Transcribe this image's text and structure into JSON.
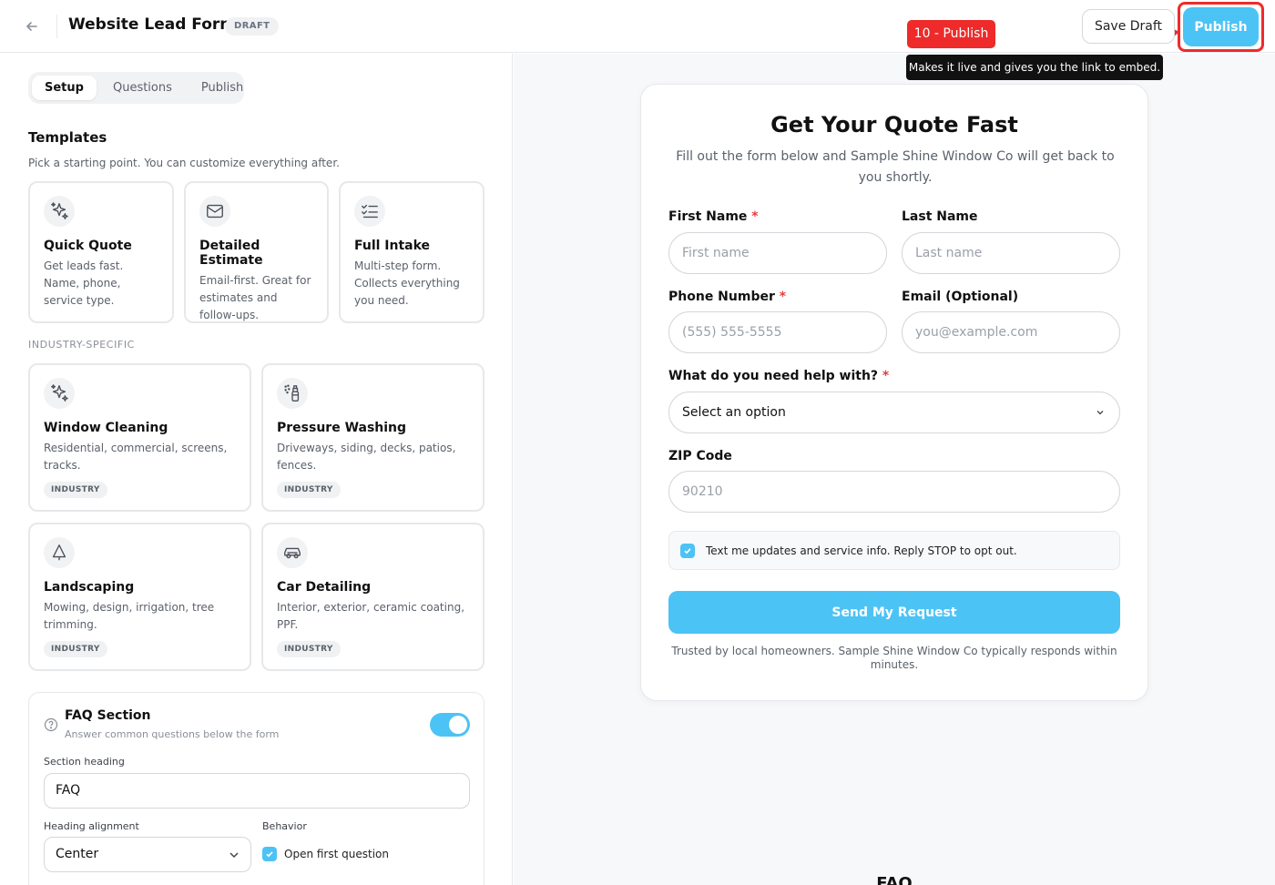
{
  "header": {
    "title": "Website Lead Form",
    "status": "DRAFT",
    "save_draft": "Save Draft",
    "publish": "Publish",
    "step_label": "10 - Publish",
    "tooltip": "Makes it live and gives you the link to embed."
  },
  "tabs": [
    {
      "label": "Setup",
      "active": true
    },
    {
      "label": "Questions",
      "active": false
    },
    {
      "label": "Publish",
      "active": false
    }
  ],
  "templates": {
    "title": "Templates",
    "subtitle": "Pick a starting point. You can customize everything after.",
    "items": [
      {
        "title": "Quick Quote",
        "desc": "Get leads fast. Name, phone, service type.",
        "icon": "sparkles-icon"
      },
      {
        "title": "Detailed Estimate",
        "desc": "Email-first. Great for estimates and follow-ups.",
        "icon": "mail-icon"
      },
      {
        "title": "Full Intake",
        "desc": "Multi-step form. Collects everything you need.",
        "icon": "checklist-icon"
      }
    ]
  },
  "industry": {
    "label": "INDUSTRY-SPECIFIC",
    "items": [
      {
        "title": "Window Cleaning",
        "desc": "Residential, commercial, screens, tracks.",
        "badge": "INDUSTRY",
        "icon": "sparkles-icon"
      },
      {
        "title": "Pressure Washing",
        "desc": "Driveways, siding, decks, patios, fences.",
        "badge": "INDUSTRY",
        "icon": "spray-bottle-icon"
      },
      {
        "title": "Landscaping",
        "desc": "Mowing, design, irrigation, tree trimming.",
        "badge": "INDUSTRY",
        "icon": "tree-icon"
      },
      {
        "title": "Car Detailing",
        "desc": "Interior, exterior, ceramic coating, PPF.",
        "badge": "INDUSTRY",
        "icon": "car-icon"
      }
    ]
  },
  "faq_settings": {
    "title": "FAQ Section",
    "subtitle": "Answer common questions below the form",
    "enabled": true,
    "heading_label": "Section heading",
    "heading_value": "FAQ",
    "alignment_label": "Heading alignment",
    "alignment_value": "Center",
    "behavior_label": "Behavior",
    "behavior_option": "Open first question",
    "behavior_checked": true
  },
  "preview": {
    "title": "Get Your Quote Fast",
    "subtitle": "Fill out the form below and Sample Shine Window Co will get back to you shortly.",
    "first_name_label": "First Name",
    "first_name_placeholder": "First name",
    "last_name_label": "Last Name",
    "last_name_placeholder": "Last name",
    "phone_label": "Phone Number",
    "phone_placeholder": "(555) 555-5555",
    "email_label": "Email (Optional)",
    "email_placeholder": "you@example.com",
    "help_label": "What do you need help with?",
    "help_value": "Select an option",
    "zip_label": "ZIP Code",
    "zip_placeholder": "90210",
    "required_mark": "*",
    "consent": "Text me updates and service info. Reply STOP to opt out.",
    "consent_checked": true,
    "submit": "Send My Request",
    "trust": "Trusted by local homeowners. Sample Shine Window Co typically responds within minutes.",
    "faq_heading": "FAQ"
  },
  "colors": {
    "accent": "#4cc3f5",
    "highlight": "#ef2b2b",
    "required": "#e53e3e"
  }
}
